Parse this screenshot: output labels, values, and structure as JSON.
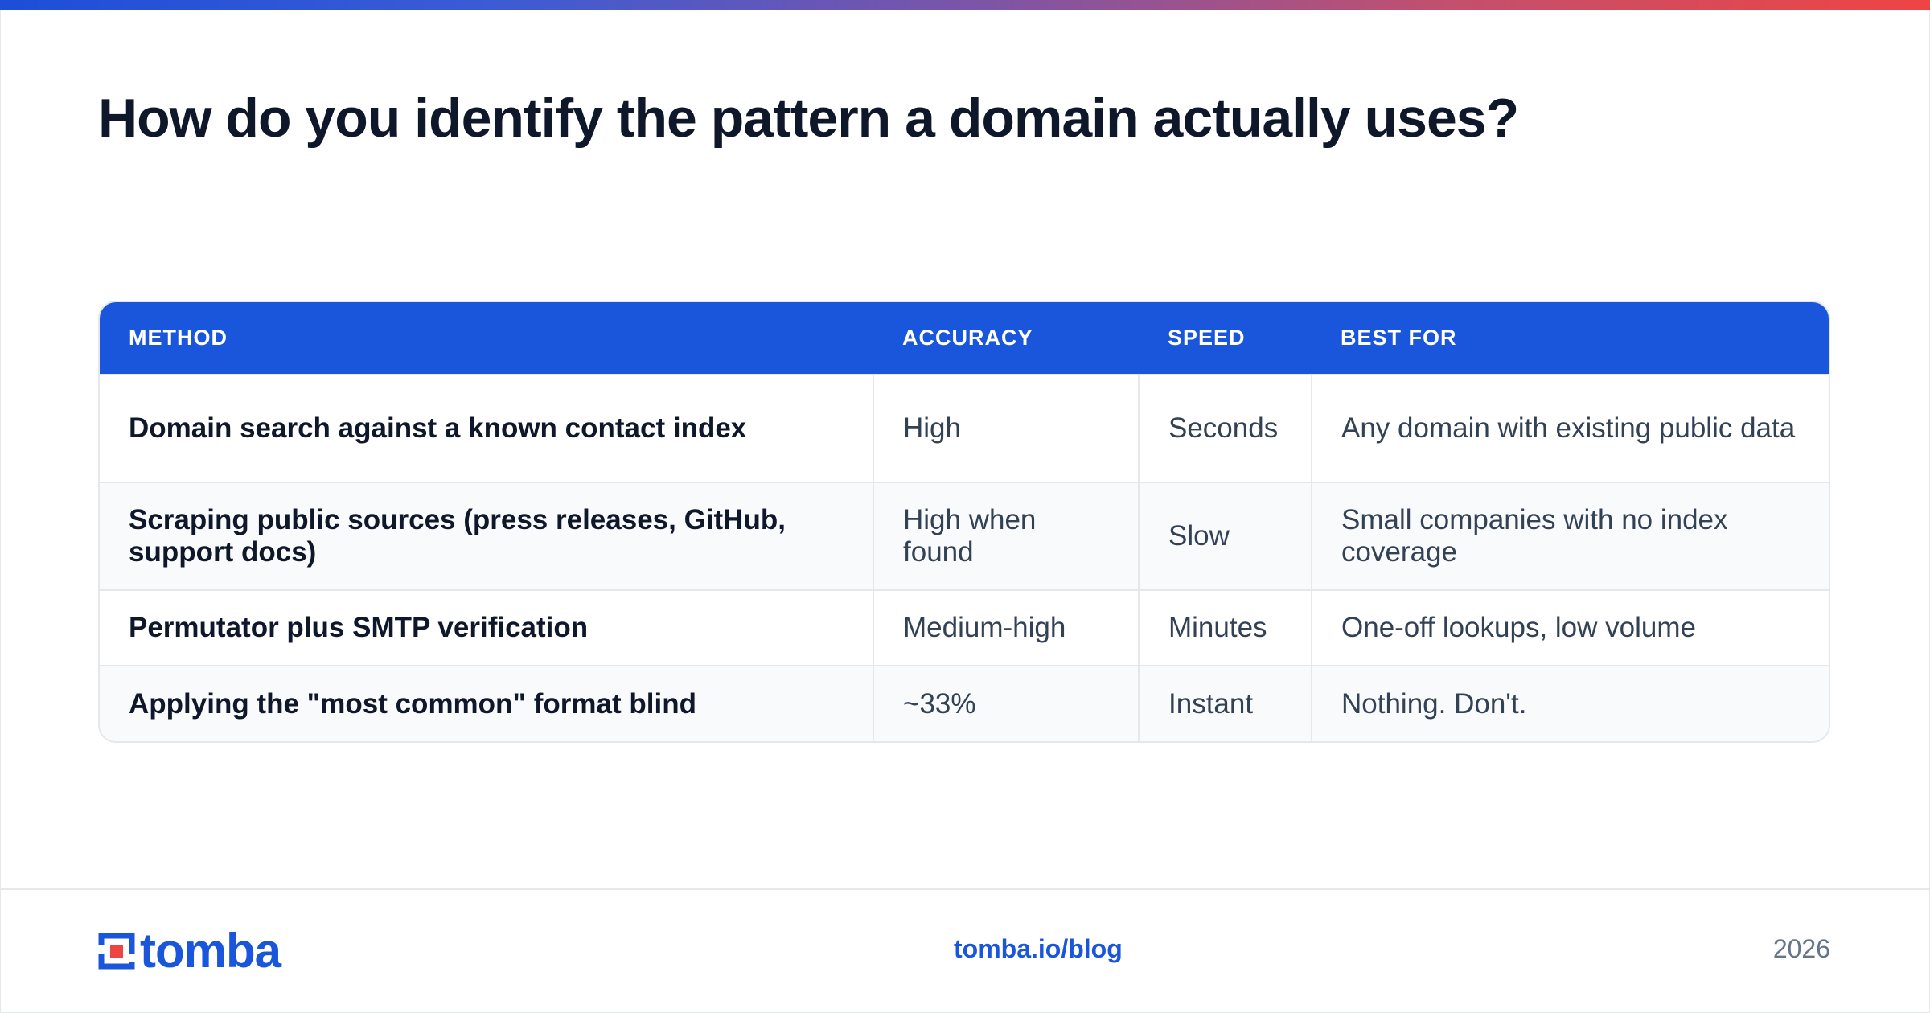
{
  "title": "How do you identify the pattern a domain actually uses?",
  "table": {
    "headers": [
      "METHOD",
      "ACCURACY",
      "SPEED",
      "BEST FOR"
    ],
    "rows": [
      [
        "Domain search against a known contact index",
        "High",
        "Seconds",
        "Any domain with existing public data"
      ],
      [
        "Scraping public sources (press releases, GitHub, support docs)",
        "High when found",
        "Slow",
        "Small companies with no index coverage"
      ],
      [
        "Permutator plus SMTP verification",
        "Medium-high",
        "Minutes",
        "One-off lookups, low volume"
      ],
      [
        "Applying the \"most common\" format blind",
        "~33%",
        "Instant",
        "Nothing. Don't."
      ]
    ]
  },
  "footer": {
    "brand": "tomba",
    "url": "tomba.io/blog",
    "year": "2026"
  },
  "colors": {
    "accent": "#1a56db",
    "title": "#0f172a",
    "logo_square": "#ef4444"
  }
}
